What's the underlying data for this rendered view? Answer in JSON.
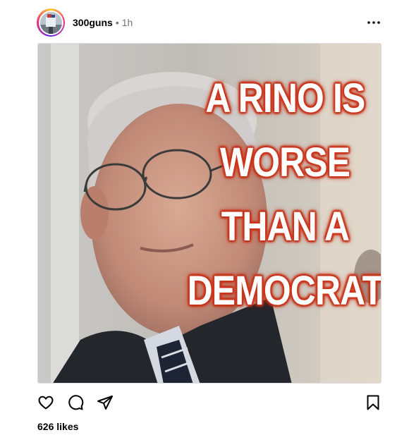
{
  "post": {
    "username": "300guns",
    "separator": "•",
    "time_ago": "1h",
    "image_caption_lines": [
      "A RINO IS",
      "WORSE",
      "THAN A",
      "DEMOCRAT"
    ],
    "likes_text": "626 likes"
  },
  "icons": {
    "more": "more-horizontal-icon",
    "like": "heart-icon",
    "comment": "comment-bubble-icon",
    "share": "paper-plane-icon",
    "save": "bookmark-icon"
  },
  "colors": {
    "text_primary": "#000000",
    "text_secondary": "#737373",
    "caption_glow": "#d4381e",
    "border": "#dbdbdb"
  }
}
